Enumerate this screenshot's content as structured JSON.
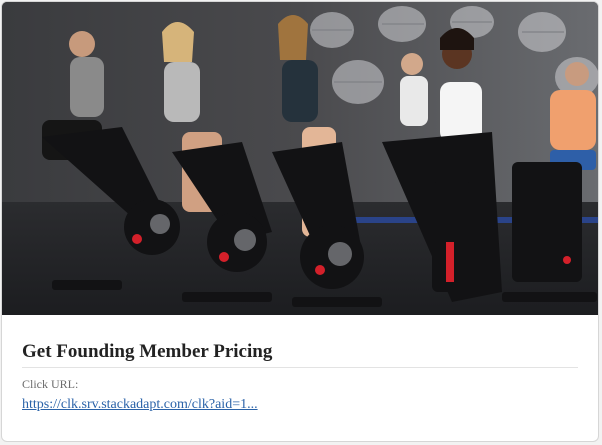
{
  "card": {
    "title": "Get Founding Member Pricing",
    "click_url_label": "Click URL:",
    "click_url_text": "https://clk.srv.stackadapt.com/clk?aid=1..."
  },
  "hero": {
    "image": "indoor-cycling-class-photo"
  },
  "colors": {
    "link": "#2a62a8",
    "title": "#222222",
    "label": "#6b6b6b"
  }
}
